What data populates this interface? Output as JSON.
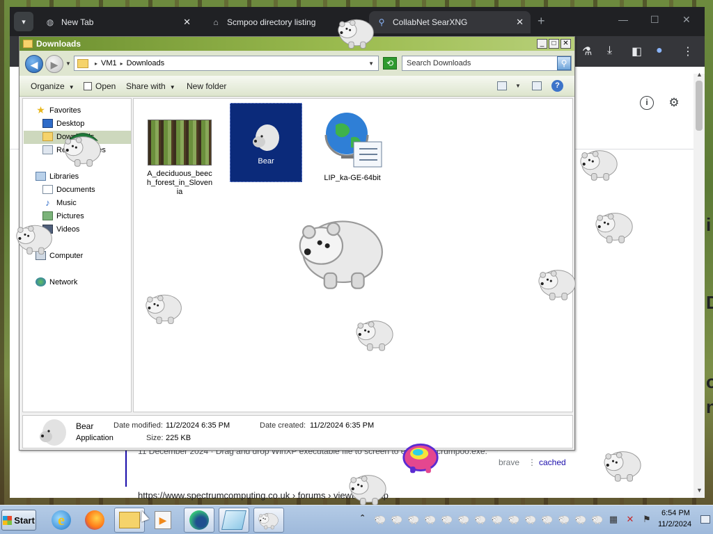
{
  "browser": {
    "tabs": [
      {
        "title": "New Tab",
        "icon": "globe-icon"
      },
      {
        "title": "Scmpoo directory listing",
        "icon": "bank-icon"
      },
      {
        "title": "CollabNet SearXNG",
        "icon": "search-icon"
      }
    ],
    "tab_close": "✕",
    "new_tab": "+",
    "minimize": "—",
    "maximize": "☐",
    "close": "✕",
    "content": {
      "snippet": "11 December 2024 · Drag and drop WinXP executable file to screen to execute scrumpoo.exe.",
      "brave_link": "brave",
      "cached_link": "cached",
      "url_line": "https://www.spectrumcomputing.co.uk › forums › viewtopic.php",
      "edge_letters": [
        "i",
        "D",
        "o",
        "n"
      ]
    }
  },
  "explorer": {
    "title": "Downloads",
    "controls": {
      "min": "_",
      "max": "□",
      "close": "✕"
    },
    "breadcrumb": [
      "VM1",
      "Downloads"
    ],
    "search_placeholder": "Search Downloads",
    "commands": {
      "organize": "Organize",
      "open": "Open",
      "share_with": "Share with",
      "new_folder": "New folder"
    },
    "help": "?",
    "nav": {
      "favorites": "Favorites",
      "fav_items": [
        "Desktop",
        "Downloads",
        "Recent Places"
      ],
      "libraries": "Libraries",
      "lib_items": [
        "Documents",
        "Music",
        "Pictures",
        "Videos"
      ],
      "computer": "Computer",
      "network": "Network"
    },
    "files": [
      {
        "name": "A_deciduous_beech_forest_in_Slovenia",
        "type": "image"
      },
      {
        "name": "Bear",
        "type": "application",
        "selected": true
      },
      {
        "name": "LIP_ka-GE-64bit",
        "type": "installer"
      }
    ],
    "details": {
      "name": "Bear",
      "type": "Application",
      "modified_label": "Date modified:",
      "modified_value": "11/2/2024 6:35 PM",
      "created_label": "Date created:",
      "created_value": "11/2/2024 6:35 PM",
      "size_label": "Size:",
      "size_value": "225 KB"
    }
  },
  "taskbar": {
    "start_label": "Start",
    "apps": [
      "internet-explorer",
      "firefox",
      "windows-explorer",
      "media-player",
      "edge",
      "file-viewer",
      "bear-app"
    ],
    "clock_time": "6:54 PM",
    "clock_date": "11/2/2024"
  },
  "colors": {
    "explorer_title": "#8fb04a",
    "selection": "#0b2a7a",
    "browser_chrome": "#202124"
  }
}
